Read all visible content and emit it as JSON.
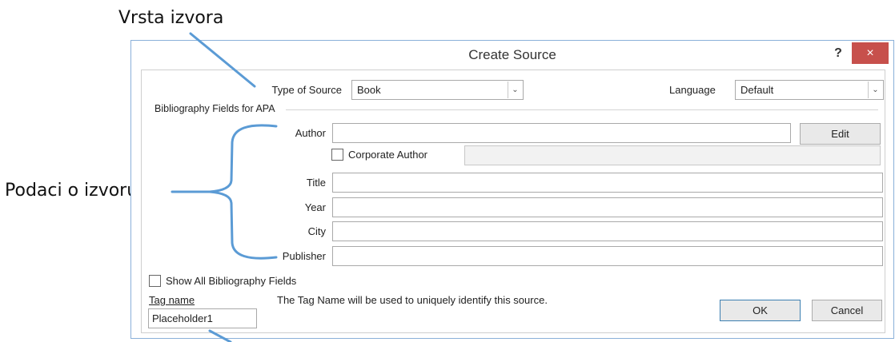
{
  "annotations": {
    "source_type": "Vrsta izvora",
    "source_data": "Podaci o izvoru"
  },
  "dialog": {
    "title": "Create Source",
    "help_label": "?",
    "close_label": "×",
    "type_of_source_label": "Type of Source",
    "type_of_source_value": "Book",
    "language_label": "Language",
    "language_value": "Default",
    "group_title": "Bibliography Fields for APA",
    "fields": {
      "author": {
        "label": "Author",
        "value": ""
      },
      "title": {
        "label": "Title",
        "value": ""
      },
      "year": {
        "label": "Year",
        "value": ""
      },
      "city": {
        "label": "City",
        "value": ""
      },
      "publisher": {
        "label": "Publisher",
        "value": ""
      }
    },
    "edit_label": "Edit",
    "corporate_author_label": "Corporate Author",
    "show_all_label": "Show All Bibliography Fields",
    "tag_name_label": "Tag name",
    "tag_name_value": "Placeholder1",
    "tag_hint": "The Tag Name will be used to uniquely identify this source.",
    "ok_label": "OK",
    "cancel_label": "Cancel",
    "chevron": "⌄"
  },
  "colors": {
    "annotation_line": "#5b9bd5",
    "close_button": "#c7504c",
    "dialog_border": "#8ab0d9"
  }
}
